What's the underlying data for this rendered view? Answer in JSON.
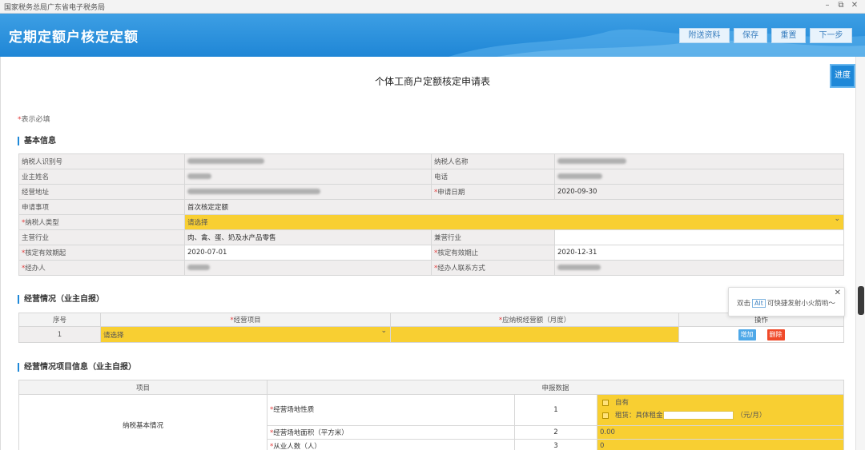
{
  "window": {
    "title": "国家税务总局广东省电子税务局"
  },
  "header": {
    "title": "定期定额户核定定额",
    "buttons": [
      "附送资料",
      "保存",
      "重置",
      "下一步"
    ]
  },
  "form_title": "个体工商户定额核定申请表",
  "progress_label": "进度",
  "required_note": "表示必填",
  "basic_info": {
    "section_title": "基本信息",
    "rows": [
      {
        "l1": "纳税人识别号",
        "l2": "纳税人名称"
      },
      {
        "l1": "业主姓名",
        "l2": "电话"
      },
      {
        "l1": "经营地址",
        "l2": "申请日期",
        "v2": "2020-09-30"
      },
      {
        "l1": "申请事项",
        "v1": "首次核定定额"
      },
      {
        "l1": "纳税人类型",
        "v1": "请选择"
      },
      {
        "l1": "主营行业",
        "v1": "肉、禽、蛋、奶及水产品零售",
        "l2": "兼营行业"
      },
      {
        "l1": "核定有效期起",
        "v1": "2020-07-01",
        "l2": "核定有效期止",
        "v2": "2020-12-31"
      },
      {
        "l1": "经办人",
        "l2": "经办人联系方式"
      }
    ]
  },
  "business": {
    "section_title": "经营情况（业主自报）",
    "headers": [
      "序号",
      "经营项目",
      "应纳税经营额（月度）",
      "操作"
    ],
    "row": {
      "no": "1",
      "item": "请选择"
    },
    "add_label": "增加",
    "delete_label": "删除"
  },
  "project_info": {
    "section_title": "经营情况项目信息（业主自报）",
    "headers": [
      "项目",
      "申报数据"
    ],
    "group_label": "纳税基本情况",
    "rows": [
      {
        "name": "经营场地性质",
        "no": "1"
      },
      {
        "name": "经营场地面积（平方米）",
        "no": "2",
        "value": "0.00"
      },
      {
        "name": "从业人数（人）",
        "no": "3",
        "value": "0"
      }
    ],
    "options": {
      "own": "自有",
      "rent": "租赁：具体租金",
      "unit": "（元/月）"
    }
  },
  "tooltip": {
    "prefix": "双击",
    "key": "Alt",
    "suffix": "可快捷发射小火箭哟～"
  },
  "colors": {
    "header_blue": "#1f86d6",
    "required_yellow": "#f8cf32",
    "delete_red": "#f04a2a",
    "add_blue": "#4ea8e8"
  }
}
